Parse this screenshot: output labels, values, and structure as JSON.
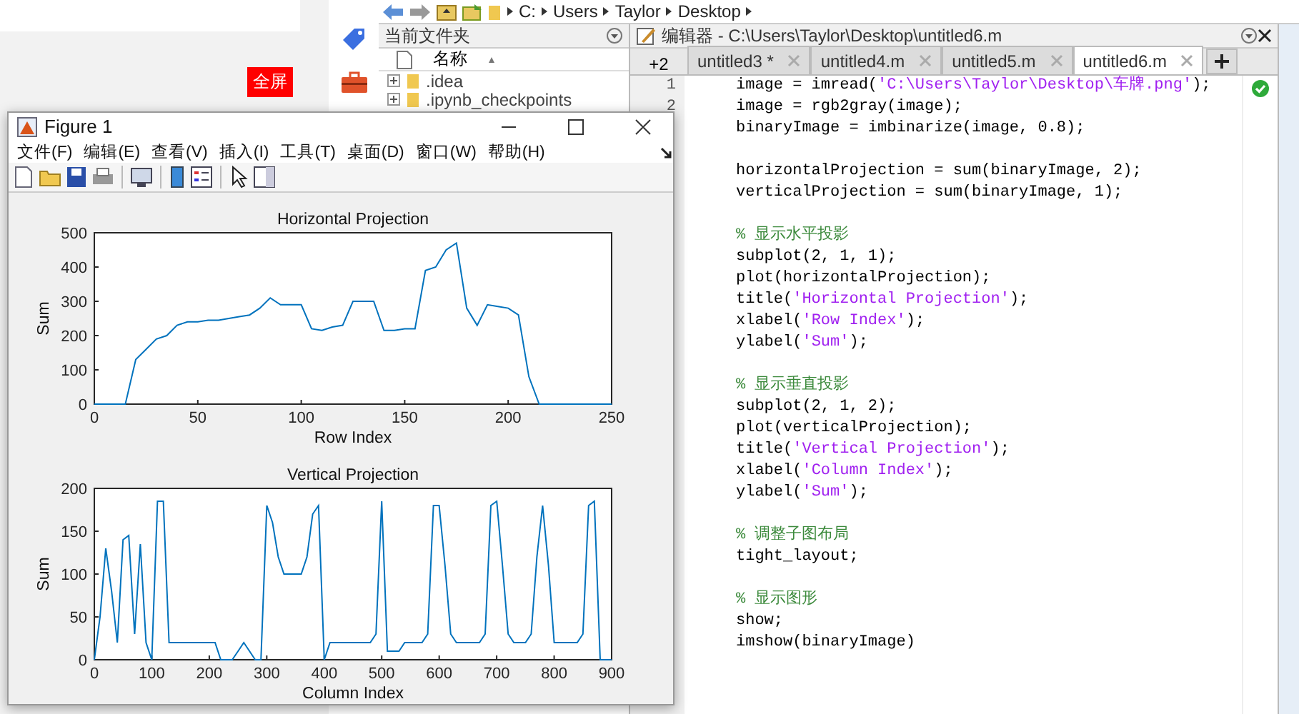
{
  "web_page": {
    "fullscreen_button": "全屏"
  },
  "address_bar": {
    "path": [
      "C:",
      "Users",
      "Taylor",
      "Desktop"
    ]
  },
  "file_browser": {
    "title": "当前文件夹",
    "column": "名称",
    "items": [
      {
        "name": ".idea"
      },
      {
        "name": ".ipynb_checkpoints"
      }
    ]
  },
  "editor": {
    "title": "编辑器 - C:\\Users\\Taylor\\Desktop\\untitled6.m",
    "overflow_count": "+2",
    "tabs": [
      {
        "label": "untitled3 *",
        "selected": false
      },
      {
        "label": "untitled4.m",
        "selected": false
      },
      {
        "label": "untitled5.m",
        "selected": false
      },
      {
        "label": "untitled6.m",
        "selected": true
      }
    ],
    "line_numbers": [
      "1",
      "2"
    ],
    "lines": [
      {
        "kind": "code",
        "tokens": [
          {
            "kind": "code",
            "text": "image = imread("
          },
          {
            "kind": "string",
            "text": "'C:\\Users\\Taylor\\Desktop\\车牌.png'"
          },
          {
            "kind": "code",
            "text": ");"
          }
        ]
      },
      {
        "kind": "code",
        "tokens": [
          {
            "kind": "code",
            "text": "image = rgb2gray(image);"
          }
        ]
      },
      {
        "kind": "code",
        "tokens": [
          {
            "kind": "code",
            "text": "binaryImage = imbinarize(image, 0.8);"
          }
        ]
      },
      {
        "kind": "blank"
      },
      {
        "kind": "code",
        "tokens": [
          {
            "kind": "code",
            "text": "horizontalProjection = sum(binaryImage, 2);"
          }
        ]
      },
      {
        "kind": "code",
        "tokens": [
          {
            "kind": "code",
            "text": "verticalProjection = sum(binaryImage, 1);"
          }
        ]
      },
      {
        "kind": "blank"
      },
      {
        "kind": "code",
        "tokens": [
          {
            "kind": "comment",
            "text": "% 显示水平投影"
          }
        ]
      },
      {
        "kind": "code",
        "tokens": [
          {
            "kind": "code",
            "text": "subplot(2, 1, 1);"
          }
        ]
      },
      {
        "kind": "code",
        "tokens": [
          {
            "kind": "code",
            "text": "plot(horizontalProjection);"
          }
        ]
      },
      {
        "kind": "code",
        "tokens": [
          {
            "kind": "code",
            "text": "title("
          },
          {
            "kind": "string",
            "text": "'Horizontal Projection'"
          },
          {
            "kind": "code",
            "text": ");"
          }
        ]
      },
      {
        "kind": "code",
        "tokens": [
          {
            "kind": "code",
            "text": "xlabel("
          },
          {
            "kind": "string",
            "text": "'Row Index'"
          },
          {
            "kind": "code",
            "text": ");"
          }
        ]
      },
      {
        "kind": "code",
        "tokens": [
          {
            "kind": "code",
            "text": "ylabel("
          },
          {
            "kind": "string",
            "text": "'Sum'"
          },
          {
            "kind": "code",
            "text": ");"
          }
        ]
      },
      {
        "kind": "blank"
      },
      {
        "kind": "code",
        "tokens": [
          {
            "kind": "comment",
            "text": "% 显示垂直投影"
          }
        ]
      },
      {
        "kind": "code",
        "tokens": [
          {
            "kind": "code",
            "text": "subplot(2, 1, 2);"
          }
        ]
      },
      {
        "kind": "code",
        "tokens": [
          {
            "kind": "code",
            "text": "plot(verticalProjection);"
          }
        ]
      },
      {
        "kind": "code",
        "tokens": [
          {
            "kind": "code",
            "text": "title("
          },
          {
            "kind": "string",
            "text": "'Vertical Projection'"
          },
          {
            "kind": "code",
            "text": ");"
          }
        ]
      },
      {
        "kind": "code",
        "tokens": [
          {
            "kind": "code",
            "text": "xlabel("
          },
          {
            "kind": "string",
            "text": "'Column Index'"
          },
          {
            "kind": "code",
            "text": ");"
          }
        ]
      },
      {
        "kind": "code",
        "tokens": [
          {
            "kind": "code",
            "text": "ylabel("
          },
          {
            "kind": "string",
            "text": "'Sum'"
          },
          {
            "kind": "code",
            "text": ");"
          }
        ]
      },
      {
        "kind": "blank"
      },
      {
        "kind": "code",
        "tokens": [
          {
            "kind": "comment",
            "text": "% 调整子图布局"
          }
        ]
      },
      {
        "kind": "code",
        "tokens": [
          {
            "kind": "code",
            "text": "tight_layout;"
          }
        ]
      },
      {
        "kind": "blank"
      },
      {
        "kind": "code",
        "tokens": [
          {
            "kind": "comment",
            "text": "% 显示图形"
          }
        ]
      },
      {
        "kind": "code",
        "tokens": [
          {
            "kind": "code",
            "text": "show;"
          }
        ]
      },
      {
        "kind": "code",
        "tokens": [
          {
            "kind": "code",
            "text": "imshow(binaryImage)"
          }
        ]
      }
    ]
  },
  "figure": {
    "title": "Figure 1",
    "menu": [
      "文件(F)",
      "编辑(E)",
      "查看(V)",
      "插入(I)",
      "工具(T)",
      "桌面(D)",
      "窗口(W)",
      "帮助(H)"
    ],
    "axes": [
      {
        "chart_data": {
          "type": "line",
          "title": "Horizontal Projection",
          "xlabel": "Row Index",
          "ylabel": "Sum",
          "x": [
            0,
            5,
            10,
            15,
            20,
            25,
            30,
            35,
            40,
            45,
            50,
            55,
            60,
            65,
            70,
            75,
            80,
            85,
            90,
            95,
            100,
            105,
            110,
            115,
            120,
            125,
            130,
            135,
            140,
            145,
            150,
            155,
            160,
            165,
            170,
            175,
            180,
            185,
            190,
            195,
            200,
            205,
            210,
            215,
            220,
            225,
            230,
            235,
            240,
            245,
            250
          ],
          "series": [
            {
              "color": "#0072bd",
              "values": [
                0,
                0,
                0,
                0,
                130,
                160,
                190,
                200,
                230,
                240,
                240,
                245,
                245,
                250,
                255,
                260,
                280,
                310,
                290,
                290,
                290,
                220,
                215,
                225,
                230,
                300,
                300,
                300,
                215,
                215,
                220,
                220,
                390,
                400,
                450,
                470,
                280,
                230,
                290,
                285,
                280,
                260,
                80,
                0,
                0,
                0,
                0,
                0,
                0,
                0,
                0
              ]
            }
          ],
          "xlim": [
            0,
            250
          ],
          "ylim": [
            0,
            500
          ],
          "xticks": [
            0,
            50,
            100,
            150,
            200,
            250
          ],
          "yticks": [
            0,
            100,
            200,
            300,
            400,
            500
          ]
        }
      },
      {
        "chart_data": {
          "type": "line",
          "title": "Vertical Projection",
          "xlabel": "Column Index",
          "ylabel": "Sum",
          "x": [
            0,
            10,
            20,
            30,
            40,
            50,
            60,
            70,
            80,
            90,
            100,
            110,
            120,
            130,
            140,
            150,
            160,
            170,
            180,
            190,
            200,
            210,
            220,
            230,
            240,
            250,
            260,
            270,
            280,
            290,
            300,
            310,
            320,
            330,
            340,
            350,
            360,
            370,
            380,
            390,
            400,
            410,
            420,
            430,
            440,
            450,
            460,
            470,
            480,
            490,
            500,
            510,
            520,
            530,
            540,
            550,
            560,
            570,
            580,
            590,
            600,
            610,
            620,
            630,
            640,
            650,
            660,
            670,
            680,
            690,
            700,
            710,
            720,
            730,
            740,
            750,
            760,
            770,
            780,
            790,
            800,
            810,
            820,
            830,
            840,
            850,
            860,
            870,
            880,
            890,
            900
          ],
          "series": [
            {
              "color": "#0072bd",
              "values": [
                0,
                50,
                130,
                80,
                20,
                140,
                145,
                30,
                135,
                20,
                0,
                185,
                185,
                20,
                20,
                20,
                20,
                20,
                20,
                20,
                20,
                20,
                0,
                0,
                0,
                10,
                20,
                10,
                0,
                0,
                180,
                160,
                120,
                100,
                100,
                100,
                100,
                120,
                170,
                180,
                0,
                20,
                20,
                20,
                20,
                20,
                20,
                20,
                20,
                30,
                185,
                10,
                10,
                10,
                20,
                20,
                20,
                20,
                30,
                180,
                180,
                110,
                30,
                20,
                20,
                20,
                20,
                20,
                30,
                180,
                185,
                110,
                30,
                20,
                20,
                20,
                30,
                120,
                180,
                110,
                20,
                20,
                20,
                20,
                20,
                30,
                180,
                185,
                0,
                0,
                0
              ]
            }
          ],
          "xlim": [
            0,
            900
          ],
          "ylim": [
            0,
            200
          ],
          "xticks": [
            0,
            100,
            200,
            300,
            400,
            500,
            600,
            700,
            800,
            900
          ],
          "yticks": [
            0,
            50,
            100,
            150,
            200
          ]
        }
      }
    ]
  }
}
